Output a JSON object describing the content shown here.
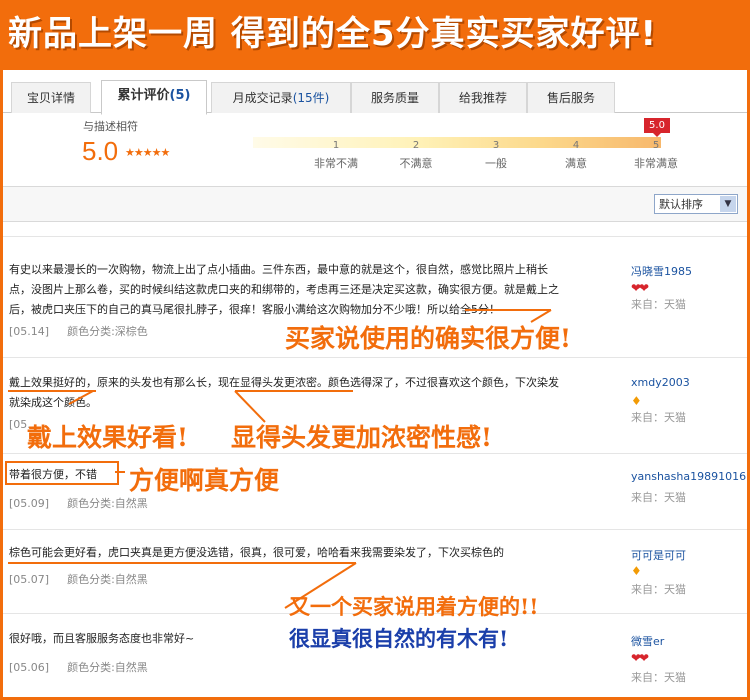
{
  "banner": {
    "title": "新品上架一周 得到的全5分真实买家好评!"
  },
  "tabs": [
    {
      "label": "宝贝详情"
    },
    {
      "label": "累计评价",
      "count": "(5)"
    },
    {
      "label": "月成交记录",
      "count": "(15件)"
    },
    {
      "label": "服务质量"
    },
    {
      "label": "给我推荐"
    },
    {
      "label": "售后服务"
    }
  ],
  "summary": {
    "match_label": "与描述相符",
    "score": "5.0",
    "stars": "★★★★★",
    "flag": "5.0",
    "scale": [
      {
        "num": "1",
        "label": "非常不满"
      },
      {
        "num": "2",
        "label": "不满意"
      },
      {
        "num": "3",
        "label": "一般"
      },
      {
        "num": "4",
        "label": "满意"
      },
      {
        "num": "5",
        "label": "非常满意"
      }
    ]
  },
  "sort": {
    "label": "默认排序",
    "arrow": "▼"
  },
  "reviews": [
    {
      "lines": [
        "有史以来最漫长的一次购物，物流上出了点小插曲。三件东西，最中意的就是这个，很自然，感觉比照片上稍长",
        "点，没图片上那么卷，买的时候纠结这款虎口夹的和绑带的，考虑再三还是决定买这款，确实很方便。就是戴上之",
        "后，被虎口夹压下的自己的真马尾很扎脖子，很痒！客服小满给这次购物加分不少哦！所以给全5分！"
      ],
      "date": "[05.14]",
      "category": "颜色分类:深棕色",
      "user": "冯晓雪1985",
      "badge": "❤❤",
      "source": "来自：天猫"
    },
    {
      "lines": [
        "戴上效果挺好的，原来的头发也有那么长，现在显得头发更浓密。颜色选得深了，不过很喜欢这个颜色，下次染发",
        "就染成这个颜色。"
      ],
      "date": "[05.",
      "category": "",
      "user": "xmdy2003",
      "badge": "♦",
      "source": "来自：天猫"
    },
    {
      "lines": [
        "带着很方便，不错"
      ],
      "date": "[05.09]",
      "category": "颜色分类:自然黑",
      "user": "yanshasha19891016",
      "badge": "",
      "source": "来自：天猫"
    },
    {
      "lines": [
        "棕色可能会更好看，虎口夹真是更方便没选错，很真，很可爱，哈哈看来我需要染发了，下次买棕色的"
      ],
      "date": "[05.07]",
      "category": "颜色分类:自然黑",
      "user": "可可是可可",
      "badge": "♦",
      "source": "来自：天猫"
    },
    {
      "lines": [
        "很好哦，而且客服服务态度也非常好~"
      ],
      "date": "[05.06]",
      "category": "颜色分类:自然黑",
      "user": "微雪er",
      "badge": "❤❤",
      "source": "来自：天猫"
    }
  ],
  "overlays": {
    "o1": "买家说使用的确实很方便!",
    "o2a": "戴上效果好看!",
    "o2b": "显得头发更加浓密性感!",
    "o3": "方便啊真方便",
    "o4a": "又一个买家说用着方便的!!",
    "o4b": "很显真很自然的有木有!"
  },
  "colors": {
    "accent": "#f26d0c",
    "link": "#1b53a0",
    "flag": "#d7252c"
  }
}
